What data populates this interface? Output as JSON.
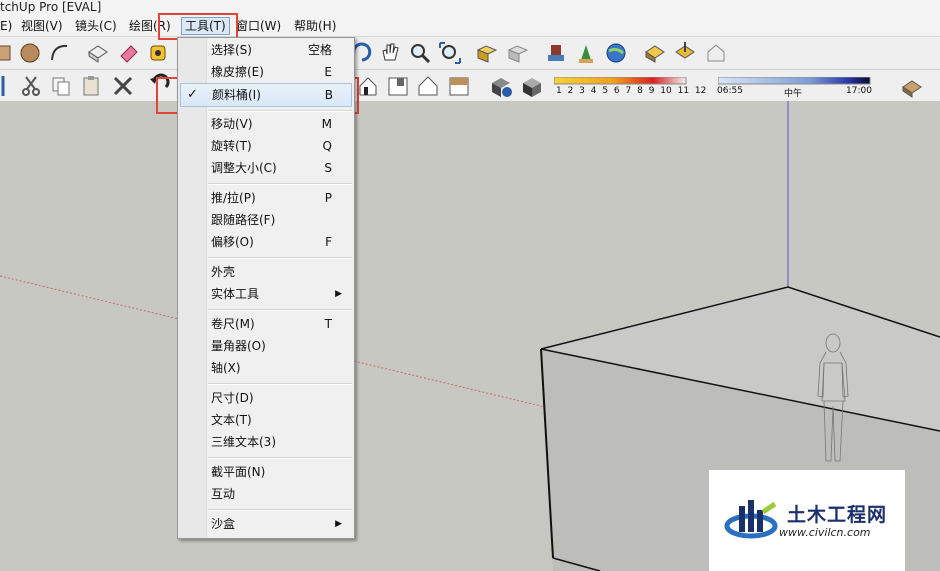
{
  "window": {
    "title": "tchUp Pro [EVAL]"
  },
  "menubar": {
    "items": [
      {
        "label": "E)"
      },
      {
        "label": "视图(V)"
      },
      {
        "label": "镜头(C)"
      },
      {
        "label": "绘图(R)"
      },
      {
        "label": "工具(T)"
      },
      {
        "label": "窗口(W)"
      },
      {
        "label": "帮助(H)"
      }
    ]
  },
  "tools_menu": {
    "items": [
      {
        "label": "选择(S)",
        "shortcut": "空格"
      },
      {
        "label": "橡皮擦(E)",
        "shortcut": "E"
      },
      {
        "label": "颜料桶(I)",
        "shortcut": "B",
        "checked": true
      },
      {
        "label": "移动(V)",
        "shortcut": "M"
      },
      {
        "label": "旋转(T)",
        "shortcut": "Q"
      },
      {
        "label": "调整大小(C)",
        "shortcut": "S"
      },
      {
        "label": "推/拉(P)",
        "shortcut": "P"
      },
      {
        "label": "跟随路径(F)",
        "shortcut": ""
      },
      {
        "label": "偏移(O)",
        "shortcut": "F"
      },
      {
        "label": "外壳",
        "shortcut": ""
      },
      {
        "label": "实体工具",
        "shortcut": "",
        "submenu": true
      },
      {
        "label": "卷尺(M)",
        "shortcut": "T"
      },
      {
        "label": "量角器(O)",
        "shortcut": ""
      },
      {
        "label": "轴(X)",
        "shortcut": ""
      },
      {
        "label": "尺寸(D)",
        "shortcut": ""
      },
      {
        "label": "文本(T)",
        "shortcut": ""
      },
      {
        "label": "三维文本(3)",
        "shortcut": ""
      },
      {
        "label": "截平面(N)",
        "shortcut": ""
      },
      {
        "label": "互动",
        "shortcut": ""
      },
      {
        "label": "沙盒",
        "shortcut": "",
        "submenu": true
      }
    ],
    "check_mark": "✓",
    "submenu_arrow": "▶"
  },
  "shadow_bar": {
    "month_ticks": "1 2 3 4 5 6 7 8 9 10 11 12",
    "time_start": "06:55",
    "time_mid": "中午",
    "time_end": "17:00"
  },
  "watermark": {
    "title": "土木工程网",
    "url": "www.civilcn.com"
  },
  "colors": {
    "highlight_box": "#e0443a",
    "viewport_bg": "#c8c8c3",
    "menu_bg": "#f0f0f0"
  }
}
